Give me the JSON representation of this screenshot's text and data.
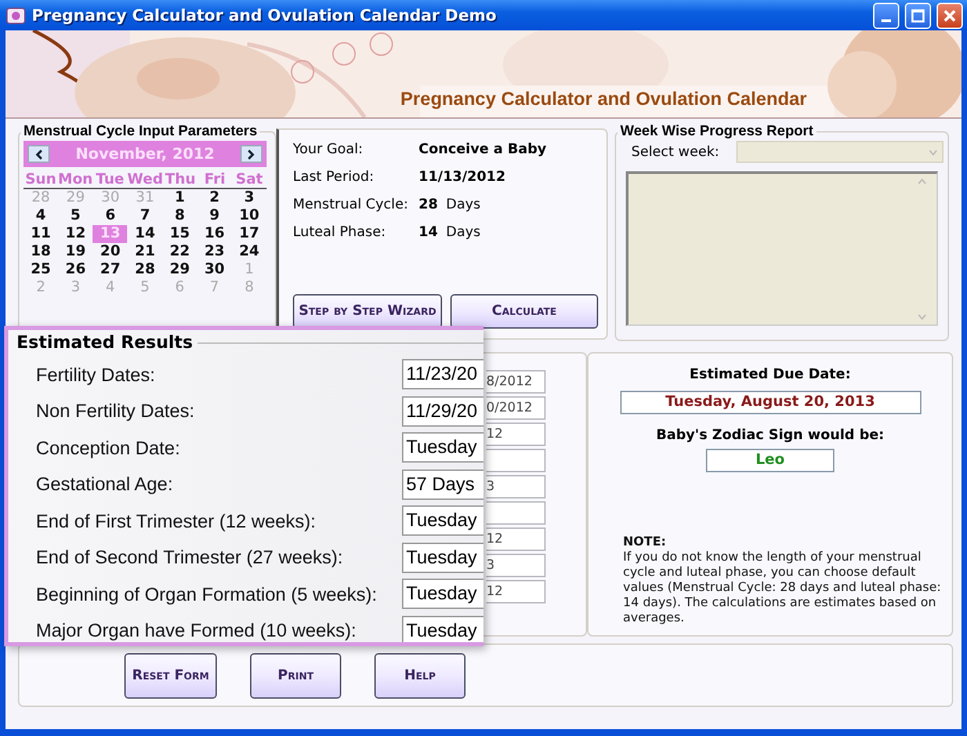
{
  "window": {
    "title": "Pregnancy Calculator and Ovulation Calendar Demo"
  },
  "banner": {
    "kind": "picture",
    "title": "Pregnancy Calculator and Ovulation Calendar"
  },
  "input_panel": {
    "title": "Menstrual Cycle Input Parameters",
    "calendar": {
      "month": "November, 2012",
      "weekdays": [
        "Sun",
        "Mon",
        "Tue",
        "Wed",
        "Thu",
        "Fri",
        "Sat"
      ],
      "weeks": [
        [
          {
            "day": "28",
            "other_month": true,
            "selected": false
          },
          {
            "day": "29",
            "other_month": true,
            "selected": false
          },
          {
            "day": "30",
            "other_month": true,
            "selected": false
          },
          {
            "day": "31",
            "other_month": true,
            "selected": false
          },
          {
            "day": "1",
            "other_month": false,
            "selected": false
          },
          {
            "day": "2",
            "other_month": false,
            "selected": false
          },
          {
            "day": "3",
            "other_month": false,
            "selected": false
          }
        ],
        [
          {
            "day": "4",
            "other_month": false,
            "selected": false
          },
          {
            "day": "5",
            "other_month": false,
            "selected": false
          },
          {
            "day": "6",
            "other_month": false,
            "selected": false
          },
          {
            "day": "7",
            "other_month": false,
            "selected": false
          },
          {
            "day": "8",
            "other_month": false,
            "selected": false
          },
          {
            "day": "9",
            "other_month": false,
            "selected": false
          },
          {
            "day": "10",
            "other_month": false,
            "selected": false
          }
        ],
        [
          {
            "day": "11",
            "other_month": false,
            "selected": false
          },
          {
            "day": "12",
            "other_month": false,
            "selected": false
          },
          {
            "day": "13",
            "other_month": false,
            "selected": true
          },
          {
            "day": "14",
            "other_month": false,
            "selected": false
          },
          {
            "day": "15",
            "other_month": false,
            "selected": false
          },
          {
            "day": "16",
            "other_month": false,
            "selected": false
          },
          {
            "day": "17",
            "other_month": false,
            "selected": false
          }
        ],
        [
          {
            "day": "18",
            "other_month": false,
            "selected": false
          },
          {
            "day": "19",
            "other_month": false,
            "selected": false
          },
          {
            "day": "20",
            "other_month": false,
            "selected": false
          },
          {
            "day": "21",
            "other_month": false,
            "selected": false
          },
          {
            "day": "22",
            "other_month": false,
            "selected": false
          },
          {
            "day": "23",
            "other_month": false,
            "selected": false
          },
          {
            "day": "24",
            "other_month": false,
            "selected": false
          }
        ],
        [
          {
            "day": "25",
            "other_month": false,
            "selected": false
          },
          {
            "day": "26",
            "other_month": false,
            "selected": false
          },
          {
            "day": "27",
            "other_month": false,
            "selected": false
          },
          {
            "day": "28",
            "other_month": false,
            "selected": false
          },
          {
            "day": "29",
            "other_month": false,
            "selected": false
          },
          {
            "day": "30",
            "other_month": false,
            "selected": false
          },
          {
            "day": "1",
            "other_month": true,
            "selected": false
          }
        ],
        [
          {
            "day": "2",
            "other_month": true,
            "selected": false
          },
          {
            "day": "3",
            "other_month": true,
            "selected": false
          },
          {
            "day": "4",
            "other_month": true,
            "selected": false
          },
          {
            "day": "5",
            "other_month": true,
            "selected": false
          },
          {
            "day": "6",
            "other_month": true,
            "selected": false
          },
          {
            "day": "7",
            "other_month": true,
            "selected": false
          },
          {
            "day": "8",
            "other_month": true,
            "selected": false
          }
        ]
      ]
    }
  },
  "summary": {
    "fields": [
      {
        "label": "Your Goal:",
        "value": "Conceive a Baby"
      },
      {
        "label": "Last Period:",
        "value": "11/13/2012"
      },
      {
        "label": "Menstrual Cycle:",
        "value": "28",
        "unit": "Days"
      },
      {
        "label": "Luteal Phase:",
        "value": "14",
        "unit": "Days"
      }
    ],
    "buttons": [
      "Step by Step Wizard",
      "Calculate"
    ]
  },
  "week_report": {
    "title": "Week Wise Progress Report",
    "select_label": "Select week:",
    "select_disabled": true
  },
  "result_fields": [
    {
      "kind": "text",
      "value": "8/2012"
    },
    {
      "kind": "text",
      "value": "0/2012"
    },
    {
      "kind": "text",
      "value": "12"
    },
    {
      "kind": "blank"
    },
    {
      "kind": "text",
      "value": "3"
    },
    {
      "kind": "blank"
    },
    {
      "kind": "text",
      "value": "12"
    },
    {
      "kind": "text",
      "value": "3"
    },
    {
      "kind": "text",
      "value": "12"
    }
  ],
  "due": {
    "label": "Estimated Due Date:",
    "value": "Tuesday, August 20, 2013",
    "zodiac_label": "Baby's Zodiac Sign would be:",
    "zodiac_value": "Leo",
    "note_title": "NOTE:",
    "note": "If you do not know the length of your menstrual cycle and luteal phase, you can choose default values (Menstrual Cycle: 28 days and luteal phase: 14 days). The calculations are estimates based on averages."
  },
  "buttons": [
    "Reset Form",
    "Print",
    "Help"
  ],
  "estimated_results": {
    "title": "Estimated Results",
    "rows": [
      {
        "label": "Fertility Dates:",
        "value": "11/23/20"
      },
      {
        "label": "Non Fertility Dates:",
        "value": "11/29/20"
      },
      {
        "label": "Conception Date:",
        "value": "Tuesday"
      },
      {
        "label": "Gestational Age:",
        "value": "57 Days"
      },
      {
        "label": "End of First Trimester (12 weeks):",
        "value": "Tuesday"
      },
      {
        "label": "End of Second Trimester (27 weeks):",
        "value": "Tuesday"
      },
      {
        "label": "Beginning of Organ Formation (5 weeks):",
        "value": "Tuesday"
      },
      {
        "label": "Major Organ have Formed (10 weeks):",
        "value": "Tuesday"
      }
    ]
  }
}
